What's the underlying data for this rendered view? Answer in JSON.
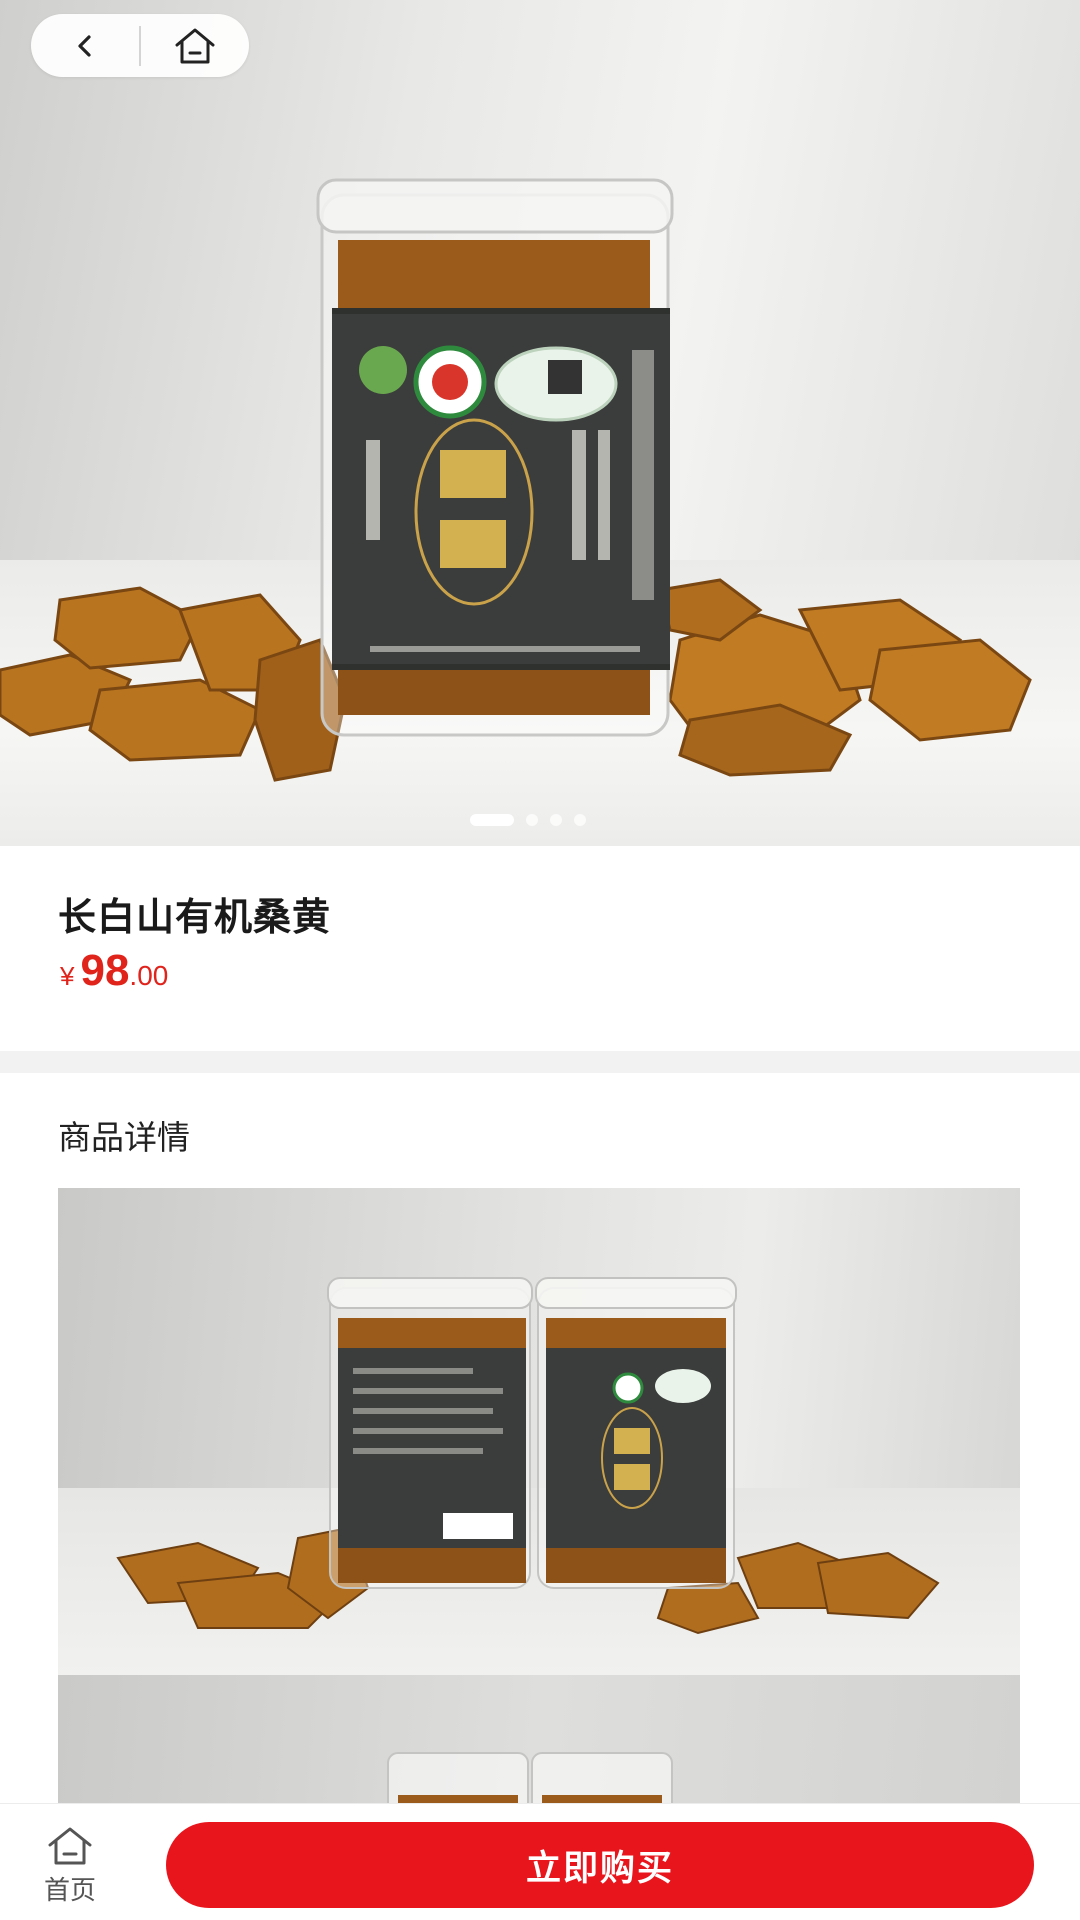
{
  "product": {
    "title": "长白山有机桑黄",
    "price_symbol": "¥",
    "price_integer": "98",
    "price_decimal": ".00"
  },
  "carousel": {
    "slide_count": 4,
    "active_index": 0
  },
  "details": {
    "section_title": "商品详情"
  },
  "bottom_bar": {
    "home_label": "首页",
    "buy_label": "立即购买"
  },
  "colors": {
    "accent": "#e8151d",
    "price": "#e0231b"
  },
  "icons": {
    "back": "chevron-left-icon",
    "home": "home-icon"
  }
}
